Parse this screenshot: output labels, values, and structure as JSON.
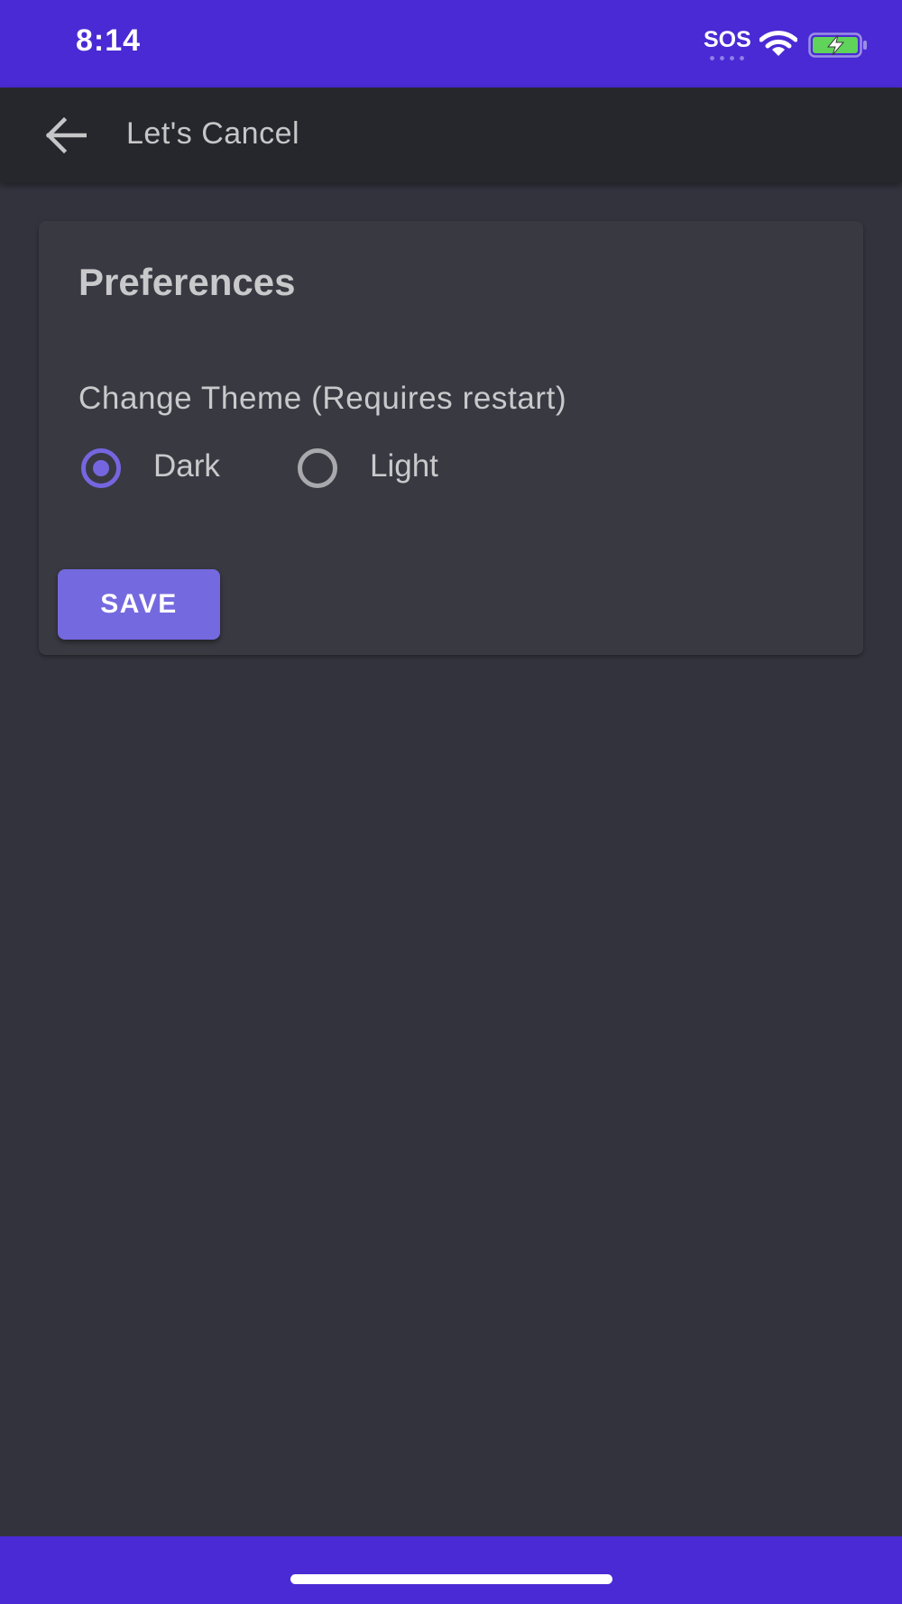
{
  "status_bar": {
    "time": "8:14",
    "sos_label": "SOS",
    "icons": [
      "wifi-icon",
      "battery-charging-icon"
    ],
    "color": "#4a2ad4"
  },
  "app_bar": {
    "back_icon": "arrow-left-icon",
    "title": "Let's Cancel"
  },
  "preferences": {
    "title": "Preferences",
    "theme_label": "Change Theme (Requires restart)",
    "theme_options": [
      {
        "label": "Dark",
        "selected": true
      },
      {
        "label": "Light",
        "selected": false
      }
    ],
    "save_label": "SAVE",
    "accent_color": "#7566e0"
  },
  "bottom_bar": {
    "color": "#4a2ad4"
  }
}
